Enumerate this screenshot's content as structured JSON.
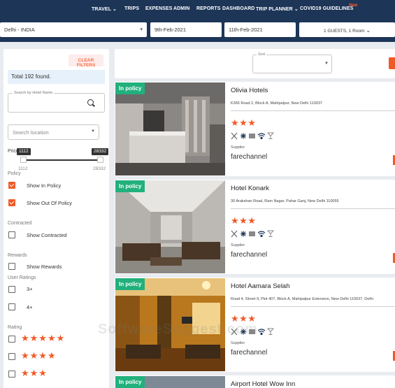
{
  "topnav": {
    "items": [
      "TRAVEL ⌄",
      "TRIPS",
      "EXPENSES",
      "ADMIN",
      "REPORTS",
      "DASHBOARD",
      "TRIP PLANNER ⌄",
      "COVID19 GUIDELINES"
    ],
    "new_badge": "New"
  },
  "search": {
    "location": "Delhi - INDIA",
    "checkin": "9th-Feb-2021",
    "checkout": "11th-Feb-2021",
    "guests": "1 GUESTS, 1 Room"
  },
  "sidebar": {
    "clear_filters": "CLEAR FILTERS",
    "total": "Total 192 found.",
    "hotel_name_label": "Search by Hotel Name",
    "location_placeholder": "Search location",
    "price": {
      "label": "Price",
      "min_tip": "1112",
      "max_tip": "28332",
      "min": "1112",
      "max": "28332"
    },
    "policy": {
      "label": "Policy",
      "in": "Show In Policy",
      "out": "Show Out Of Policy"
    },
    "contracted": {
      "label": "Contracted",
      "show": "Show Contracted"
    },
    "rewards": {
      "label": "Rewards",
      "show": "Show Rewards"
    },
    "ratings": {
      "label": "User Ratings",
      "r3": "3+",
      "r4": "4+"
    },
    "rating": {
      "label": "Rating",
      "five": "★★★★★",
      "four": "★★★★",
      "three": "★★★"
    }
  },
  "sort": {
    "label": "Sort"
  },
  "hotels": [
    {
      "tag": "In policy",
      "name": "Olivia Hotels",
      "address": "K365 Road 2, Block A, Mahipalpur, New Delhi 110037",
      "stars": "★★★",
      "supplier_label": "Supplier",
      "supplier": "farechannel"
    },
    {
      "tag": "In policy",
      "name": "Hotel Konark",
      "address": "30 Arakshan Road, Ram Nagar, Pahar Ganj, New Delhi 110055",
      "stars": "★★★",
      "supplier_label": "Supplier",
      "supplier": "farechannel"
    },
    {
      "tag": "In policy",
      "name": "Hotel Aamara Selah",
      "address": "Road 4, Street 9, Plot 407, Block A, Mahipalpur Extension, New Delhi 110037, Delhi",
      "stars": "★★★",
      "supplier_label": "Supplier",
      "supplier": "farechannel"
    },
    {
      "tag": "In policy",
      "name": "Airport Hotel Wow Inn"
    }
  ],
  "watermark": "SoftwareSuggest.com",
  "colors": {
    "navy": "#1d3557",
    "accent": "#f05a28",
    "policy_green": "#22b07d"
  }
}
